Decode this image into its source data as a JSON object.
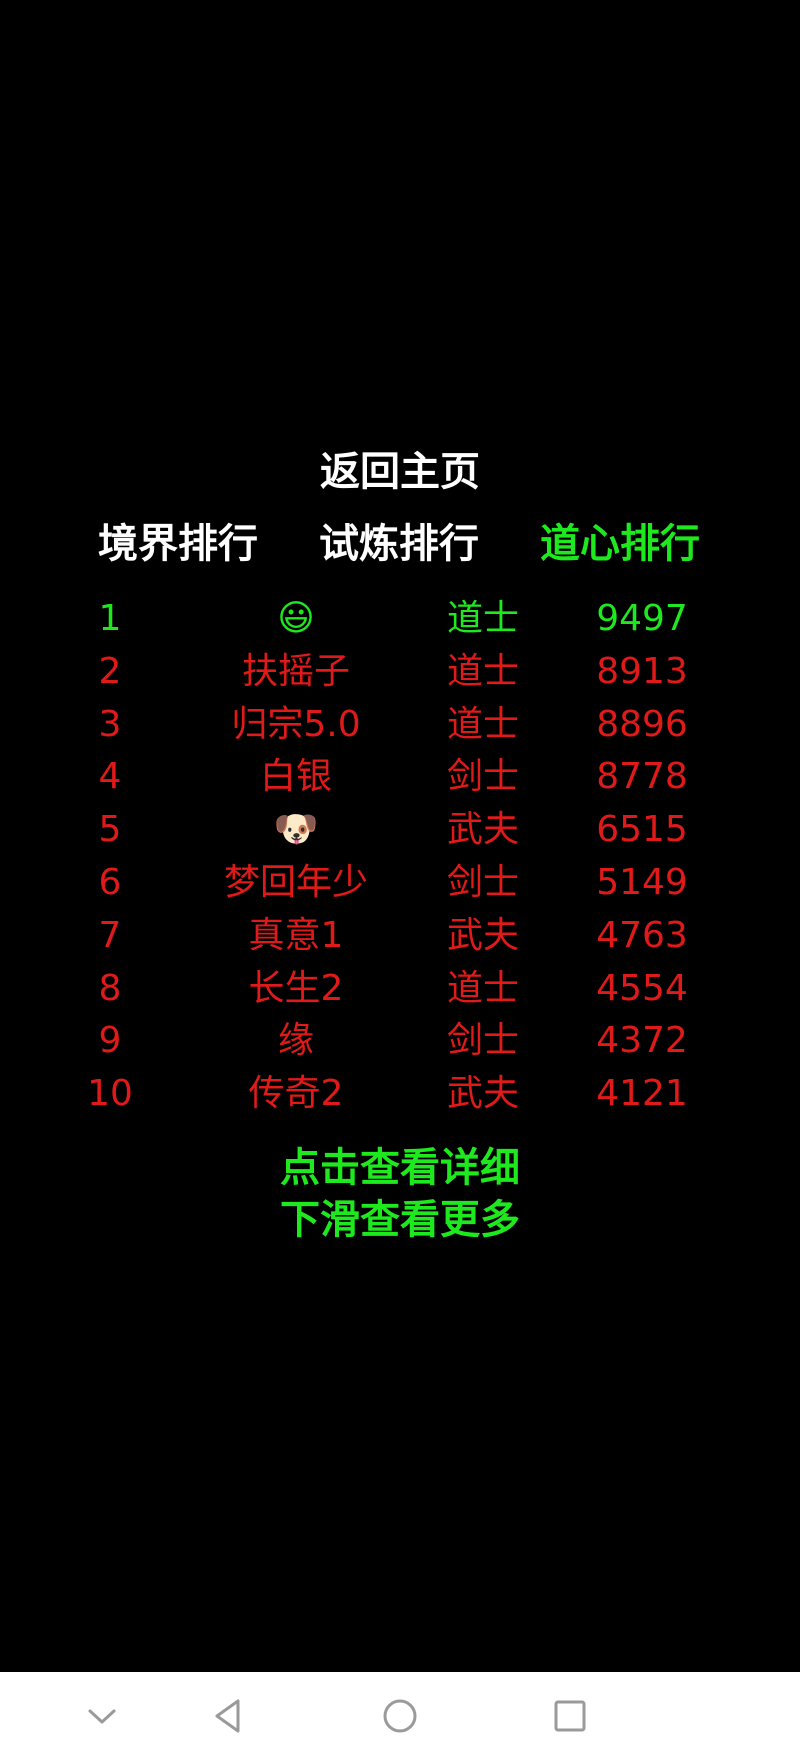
{
  "colors": {
    "background": "#000000",
    "active_green": "#1ee81e",
    "rank_red": "#e01919",
    "title_white": "#ffffff",
    "nav_bg": "#ffffff",
    "nav_icon": "#9a9a9a"
  },
  "header": {
    "back_label": "返回主页"
  },
  "tabs": [
    {
      "label": "境界排行",
      "active": false
    },
    {
      "label": "试炼排行",
      "active": false
    },
    {
      "label": "道心排行",
      "active": true
    }
  ],
  "rankings": [
    {
      "rank": "1",
      "name": "😃",
      "class": "道士",
      "score": "9497",
      "highlight": true
    },
    {
      "rank": "2",
      "name": "扶摇子",
      "class": "道士",
      "score": "8913",
      "highlight": false
    },
    {
      "rank": "3",
      "name": "归宗5.0",
      "class": "道士",
      "score": "8896",
      "highlight": false
    },
    {
      "rank": "4",
      "name": "白银",
      "class": "剑士",
      "score": "8778",
      "highlight": false
    },
    {
      "rank": "5",
      "name": "🐶",
      "class": "武夫",
      "score": "6515",
      "highlight": false
    },
    {
      "rank": "6",
      "name": "梦回年少",
      "class": "剑士",
      "score": "5149",
      "highlight": false
    },
    {
      "rank": "7",
      "name": "真意1",
      "class": "武夫",
      "score": "4763",
      "highlight": false
    },
    {
      "rank": "8",
      "name": "长生2",
      "class": "道士",
      "score": "4554",
      "highlight": false
    },
    {
      "rank": "9",
      "name": "缘",
      "class": "剑士",
      "score": "4372",
      "highlight": false
    },
    {
      "rank": "10",
      "name": "传奇2",
      "class": "武夫",
      "score": "4121",
      "highlight": false
    }
  ],
  "hints": {
    "detail": "点击查看详细",
    "more": "下滑查看更多"
  },
  "navbar": {
    "icons": [
      "chevron-down-icon",
      "back-triangle-icon",
      "home-circle-icon",
      "recents-square-icon"
    ]
  }
}
